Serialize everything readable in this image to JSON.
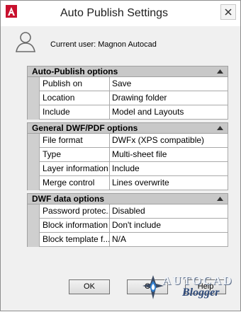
{
  "window": {
    "title": "Auto Publish Settings",
    "current_user": "Current user: Magnon Autocad"
  },
  "sections": [
    {
      "title": "Auto-Publish options",
      "rows": [
        {
          "key": "Publish on",
          "value": "Save"
        },
        {
          "key": "Location",
          "value": "Drawing folder"
        },
        {
          "key": "Include",
          "value": "Model and Layouts"
        }
      ]
    },
    {
      "title": "General DWF/PDF options",
      "rows": [
        {
          "key": "File format",
          "value": "DWFx (XPS compatible)"
        },
        {
          "key": "Type",
          "value": "Multi-sheet file"
        },
        {
          "key": "Layer information",
          "value": "Include"
        },
        {
          "key": "Merge control",
          "value": "Lines overwrite"
        }
      ]
    },
    {
      "title": "DWF data options",
      "rows": [
        {
          "key": "Password protec...",
          "value": "Disabled"
        },
        {
          "key": "Block information",
          "value": "Don't include"
        },
        {
          "key": "Block template f...",
          "value": "N/A"
        }
      ]
    }
  ],
  "buttons": {
    "ok": "OK",
    "cancel": "C",
    "help": "Help"
  },
  "watermark": {
    "line1": "AUTOCAD",
    "line2": "Blogger"
  },
  "colors": {
    "header_bg": "#c8c8c8",
    "gutter": "#cfcfcf",
    "logo_red": "#c8102e"
  }
}
